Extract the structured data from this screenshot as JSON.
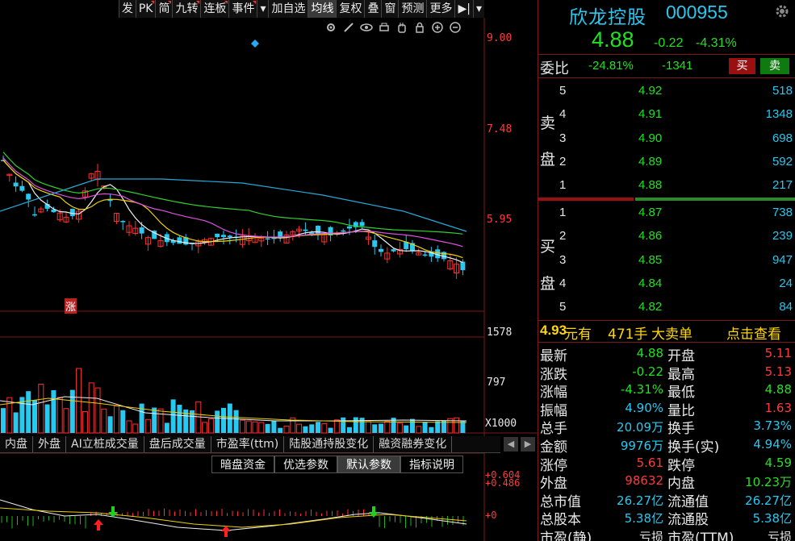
{
  "toolbar": {
    "items": [
      "发",
      "PK",
      "简",
      "九转",
      "连板",
      "事件",
      "▾",
      "加自选",
      "均线",
      "复权",
      "叠",
      "窗",
      "预测",
      "更多",
      "▶|",
      "▾"
    ],
    "active_index": 8,
    "flag_indices": [
      1,
      2,
      3,
      4,
      5
    ]
  },
  "stock": {
    "name": "欣龙控股",
    "code": "000955",
    "price": "4.88",
    "change": "-0.22",
    "change_pct": "-4.31%"
  },
  "weibi": {
    "label": "委比",
    "pct": "-24.81%",
    "diff": "-1341",
    "buy_btn": "买",
    "sell_btn": "卖"
  },
  "sell_label": [
    "卖",
    "盘"
  ],
  "buy_label": [
    "买",
    "盘"
  ],
  "sell_levels": [
    {
      "level": "5",
      "price": "4.92",
      "vol": "518"
    },
    {
      "level": "4",
      "price": "4.91",
      "vol": "1348"
    },
    {
      "level": "3",
      "price": "4.90",
      "vol": "698"
    },
    {
      "level": "2",
      "price": "4.89",
      "vol": "592"
    },
    {
      "level": "1",
      "price": "4.88",
      "vol": "217"
    }
  ],
  "buy_levels": [
    {
      "level": "1",
      "price": "4.87",
      "vol": "738"
    },
    {
      "level": "2",
      "price": "4.86",
      "vol": "239"
    },
    {
      "level": "3",
      "price": "4.85",
      "vol": "947"
    },
    {
      "level": "4",
      "price": "4.84",
      "vol": "24"
    },
    {
      "level": "5",
      "price": "4.82",
      "vol": "84"
    }
  ],
  "bigorder": {
    "price": "4.93",
    "unit1": "元有",
    "qty": "471手",
    "label": "大卖单",
    "link": "点击查看"
  },
  "stats": [
    {
      "l1": "最新",
      "v1": "4.88",
      "c1": "green",
      "l2": "开盘",
      "v2": "5.11",
      "c2": "red"
    },
    {
      "l1": "涨跌",
      "v1": "-0.22",
      "c1": "green",
      "l2": "最高",
      "v2": "5.13",
      "c2": "red"
    },
    {
      "l1": "涨幅",
      "v1": "-4.31%",
      "c1": "green",
      "l2": "最低",
      "v2": "4.88",
      "c2": "green"
    },
    {
      "l1": "振幅",
      "v1": "4.90%",
      "c1": "cyan",
      "l2": "量比",
      "v2": "1.63",
      "c2": "red"
    },
    {
      "l1": "总手",
      "v1": "20.09万",
      "c1": "cyan",
      "l2": "换手",
      "v2": "3.73%",
      "c2": "cyan"
    },
    {
      "l1": "金额",
      "v1": "9976万",
      "c1": "cyan",
      "l2": "换手(实)",
      "v2": "4.94%",
      "c2": "cyan"
    },
    {
      "l1": "涨停",
      "v1": "5.61",
      "c1": "red",
      "l2": "跌停",
      "v2": "4.59",
      "c2": "green"
    },
    {
      "l1": "外盘",
      "v1": "98632",
      "c1": "red",
      "l2": "内盘",
      "v2": "10.23万",
      "c2": "green"
    },
    {
      "l1": "总市值",
      "v1": "26.27亿",
      "c1": "cyan",
      "l2": "流通值",
      "v2": "26.27亿",
      "c2": "cyan"
    },
    {
      "l1": "总股本",
      "v1": "5.38亿",
      "c1": "cyan",
      "l2": "流通股",
      "v2": "5.38亿",
      "c2": "cyan"
    },
    {
      "l1": "市盈(静)",
      "v1": "亏损",
      "c1": "white",
      "l2": "市盈(TTM)",
      "v2": "亏损",
      "c2": "white"
    }
  ],
  "axis": {
    "price_labels": [
      "9.00",
      "7.48",
      "5.95"
    ],
    "volume_labels": [
      "1578",
      "797",
      "X1000"
    ],
    "indicator_labels": [
      "+0.604",
      "+0.486",
      "+0"
    ]
  },
  "zhang_label": "涨",
  "indicator_tabs": [
    "内盘",
    "外盘",
    "AI立桩成交量",
    "盘后成交量",
    "市盈率(ttm)",
    "陆股通持股变化",
    "融资融券变化"
  ],
  "param_tabs": [
    "暗盘资金",
    "优选参数",
    "默认参数",
    "指标说明"
  ],
  "param_selected": 2,
  "icons": [
    "gear-icon",
    "pen-icon",
    "eye-icon",
    "printer-icon",
    "hand-icon",
    "lock-icon",
    "zoom-in-icon",
    "zoom-out-icon"
  ]
}
